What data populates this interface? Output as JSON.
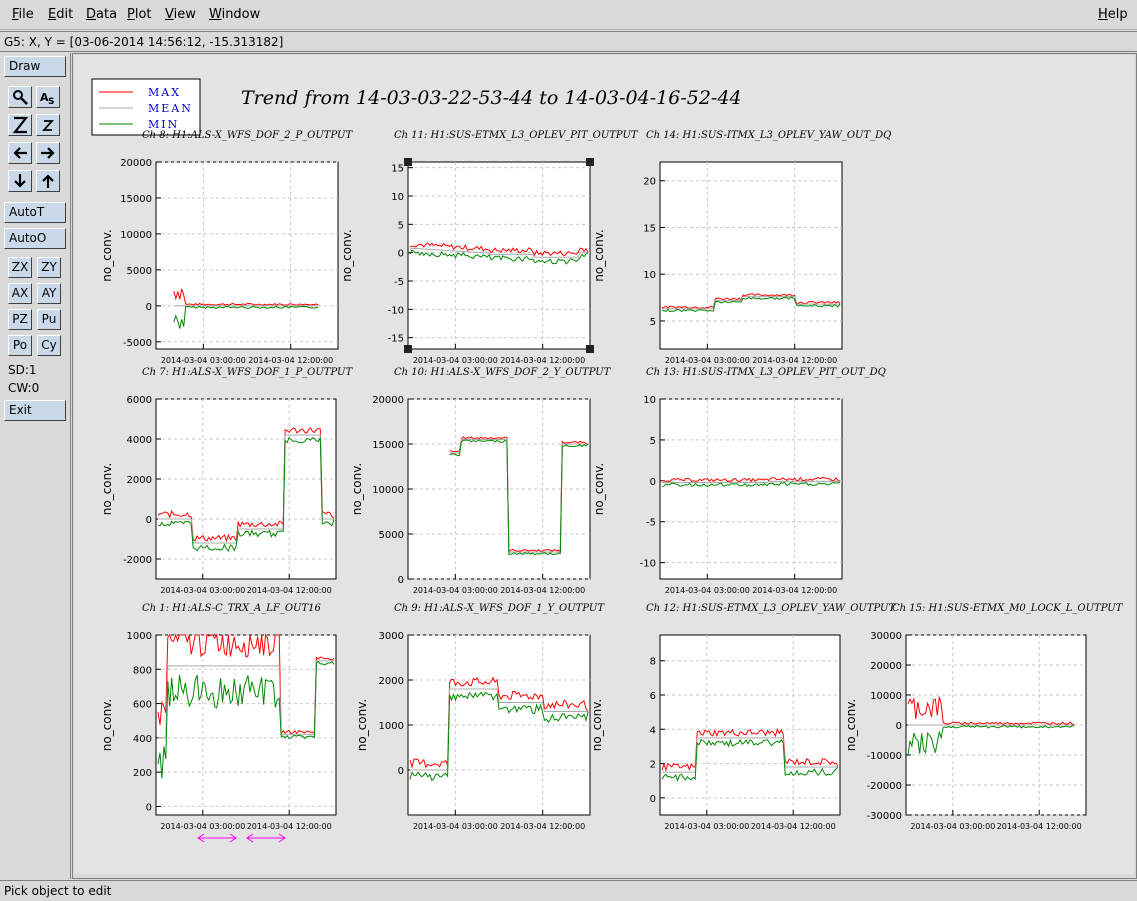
{
  "menu": {
    "items": [
      "File",
      "Edit",
      "Data",
      "Plot",
      "View",
      "Window"
    ],
    "help": "Help"
  },
  "coordinates": "G5: X, Y = [03-06-2014 14:56:12, -15.313182]",
  "toolbar": {
    "draw": "Draw",
    "autot": "AutoT",
    "autoo": "AutoO",
    "zx": "ZX",
    "zy": "ZY",
    "ax": "AX",
    "ay": "AY",
    "pz": "PZ",
    "pu": "Pu",
    "po": "Po",
    "cy": "Cy",
    "sd": "SD:1",
    "cw": "CW:0",
    "exit": "Exit"
  },
  "status": "Pick object to edit",
  "colors": {
    "max": "#ff0000",
    "mean": "#aaaaaa",
    "min": "#008800",
    "legend_text": "#0000cc",
    "arrows": "#ff00ff"
  },
  "chart_data": {
    "title": "Trend from 14-03-03-22-53-44 to 14-03-04-16-52-44",
    "legend": [
      "MAX",
      "MEAN",
      "MIN"
    ],
    "ylabel": "no_conv.",
    "xticks": [
      "2014-03-04 03:00:00",
      "2014-03-04 12:00:00"
    ],
    "panels": [
      {
        "title": "Ch 8: H1:ALS-X_WFS_DOF_2_P_OUTPUT",
        "yticks": [
          20000,
          15000,
          10000,
          5000,
          0,
          -5000
        ],
        "ylim": [
          -6000,
          20000
        ]
      },
      {
        "title": "Ch 11: H1:SUS-ETMX_L3_OPLEV_PIT_OUTPUT",
        "yticks": [
          15,
          10,
          5,
          0,
          -5,
          -10,
          -15
        ],
        "ylim": [
          -17,
          16
        ]
      },
      {
        "title": "Ch 14: H1:SUS-ITMX_L3_OPLEV_YAW_OUT_DQ",
        "yticks": [
          20,
          15,
          10,
          5
        ],
        "ylim": [
          2,
          22
        ]
      },
      {
        "title": "Ch 7: H1:ALS-X_WFS_DOF_1_P_OUTPUT",
        "yticks": [
          6000,
          4000,
          2000,
          0,
          -2000
        ],
        "ylim": [
          -3000,
          6000
        ]
      },
      {
        "title": "Ch 10: H1:ALS-X_WFS_DOF_2_Y_OUTPUT",
        "yticks": [
          20000,
          15000,
          10000,
          5000,
          0
        ],
        "ylim": [
          0,
          20000
        ]
      },
      {
        "title": "Ch 13: H1:SUS-ITMX_L3_OPLEV_PIT_OUT_DQ",
        "yticks": [
          10,
          5,
          0,
          -5,
          -10
        ],
        "ylim": [
          -12,
          10
        ]
      },
      {
        "title": "Ch 1: H1:ALS-C_TRX_A_LF_OUT16",
        "yticks": [
          1000,
          800,
          600,
          400,
          200,
          0
        ],
        "ylim": [
          -50,
          1000
        ]
      },
      {
        "title": "Ch 9: H1:ALS-X_WFS_DOF_1_Y_OUTPUT",
        "yticks": [
          3000,
          2000,
          1000,
          0
        ],
        "ylim": [
          -1000,
          3000
        ]
      },
      {
        "title": "Ch 12: H1:SUS-ETMX_L3_OPLEV_YAW_OUTPUT",
        "yticks": [
          8,
          6,
          4,
          2,
          0
        ],
        "ylim": [
          -1,
          9.5
        ]
      },
      {
        "title": "Ch 15: H1:SUS-ETMX_M0_LOCK_L_OUTPUT",
        "yticks": [
          30000,
          20000,
          10000,
          0,
          -10000,
          -20000,
          -30000
        ],
        "ylim": [
          -30000,
          30000
        ]
      }
    ]
  }
}
